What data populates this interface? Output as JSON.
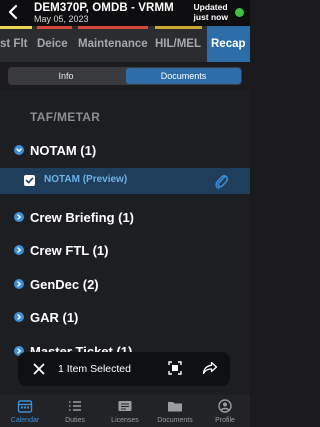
{
  "header": {
    "title": "DEM370P, OMDB - VRMM",
    "subtitle": "May 05, 2023",
    "status_line1": "Updated",
    "status_line2": "just now",
    "status_color": "#3fbf3f"
  },
  "tabs": [
    {
      "label": "st Flt",
      "bar_color": "#e8d44d"
    },
    {
      "label": "Deice",
      "bar_color": "#d6493a"
    },
    {
      "label": "Maintenance",
      "bar_color": "#d6493a"
    },
    {
      "label": "HIL/MEL",
      "bar_color": "#c9a52f"
    },
    {
      "label": "Recap",
      "bar_color": "",
      "active": true
    }
  ],
  "segment": {
    "info_label": "Info",
    "documents_label": "Documents",
    "active": "Documents"
  },
  "content": {
    "section_label": "TAF/METAR",
    "notam_label": "NOTAM  (1)",
    "selected_item_label": "NOTAM (Preview)",
    "groups": [
      {
        "label": "Crew Briefing  (1)"
      },
      {
        "label": "Crew FTL  (1)"
      },
      {
        "label": "GenDec  (2)"
      },
      {
        "label": "GAR  (1)"
      },
      {
        "label": "Master Ticket  (1)"
      }
    ]
  },
  "action_bar": {
    "selected_text": "1 Item Selected"
  },
  "bottom_nav": {
    "items": [
      {
        "label": "Calendar",
        "icon": "calendar-icon",
        "active": true
      },
      {
        "label": "Duties",
        "icon": "list-icon"
      },
      {
        "label": "Licenses",
        "icon": "license-icon"
      },
      {
        "label": "Documents",
        "icon": "folder-icon"
      },
      {
        "label": "Profile",
        "icon": "profile-icon"
      }
    ]
  },
  "colors": {
    "accent": "#2d6ea8",
    "link": "#3d8fd6"
  }
}
